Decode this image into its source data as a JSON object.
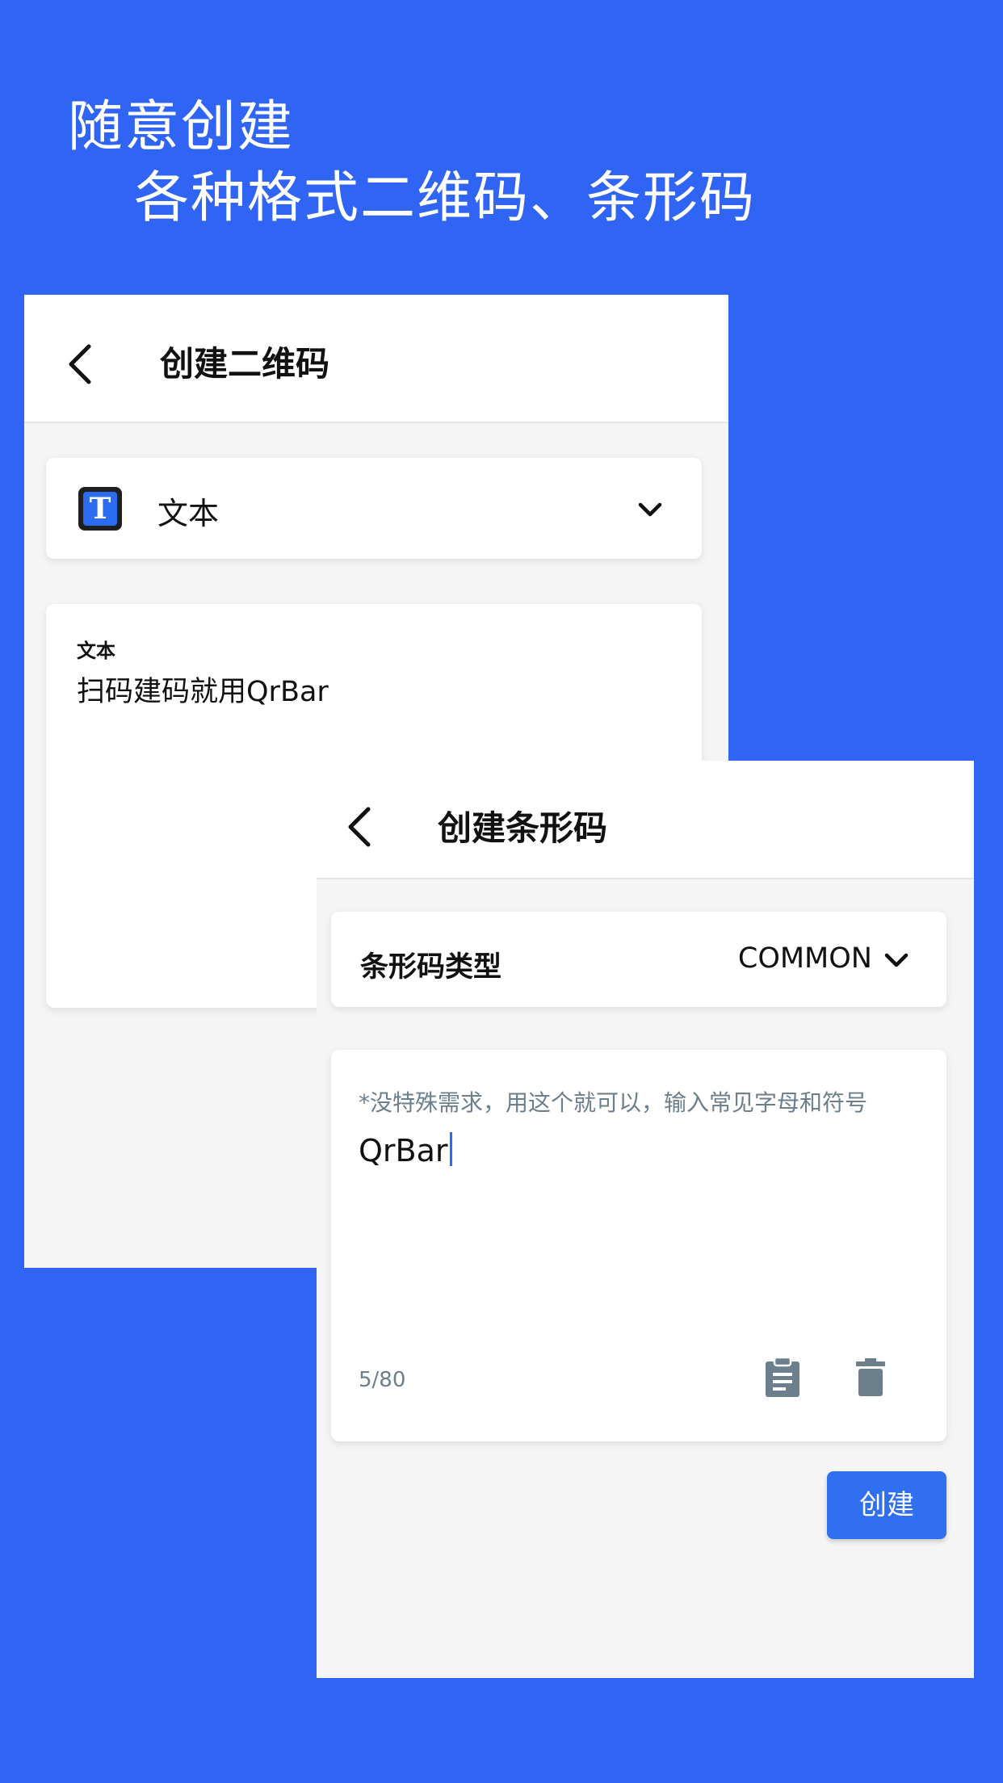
{
  "headline": {
    "line1": "随意创建",
    "line2": "各种格式二维码、条形码"
  },
  "qr_screen": {
    "title": "创建二维码",
    "type_label": "文本",
    "type_icon": "text-t-icon",
    "field_label": "文本",
    "field_value": "扫码建码就用QrBar"
  },
  "barcode_screen": {
    "title": "创建条形码",
    "type_label": "条形码类型",
    "type_value": "COMMON",
    "hint": "*没特殊需求，用这个就可以，输入常见字母和符号",
    "input_value": "QrBar",
    "counter": "5/80",
    "create_label": "创建"
  },
  "colors": {
    "background": "#3064f4",
    "accent": "#2f6ff0",
    "card_bg": "#f5f5f5",
    "icon_gray": "#6b7f8c"
  }
}
